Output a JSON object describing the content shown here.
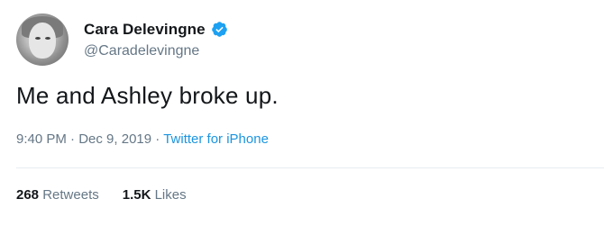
{
  "author": {
    "display_name": "Cara Delevingne",
    "handle": "@Caradelevingne",
    "verified": true
  },
  "tweet": {
    "text": "Me and Ashley broke up.",
    "time": "9:40 PM",
    "separator": "·",
    "date": "Dec 9, 2019",
    "source": "Twitter for iPhone"
  },
  "stats": {
    "retweets_count": "268",
    "retweets_label": "Retweets",
    "likes_count": "1.5K",
    "likes_label": "Likes"
  },
  "colors": {
    "verified_badge": "#1da1f2",
    "link": "#1b95e0",
    "secondary_text": "#657786"
  },
  "icons": {
    "verified": "verified-badge-icon"
  }
}
